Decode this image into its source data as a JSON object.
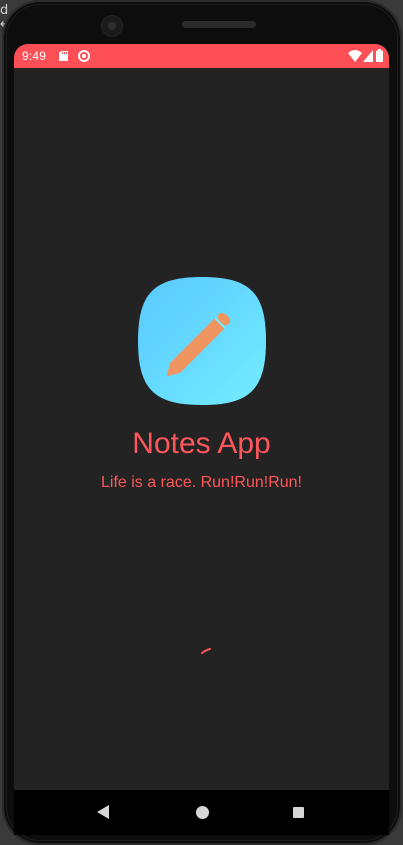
{
  "status_bar": {
    "time": "9:49",
    "icons": [
      "sd-card-icon",
      "data-saver-icon",
      "wifi-icon",
      "signal-icon",
      "battery-icon"
    ],
    "background_color": "#ff4f56"
  },
  "app": {
    "title": "Notes App",
    "tagline": "Life is a race. Run!Run!Run!",
    "icon": "pencil-icon",
    "accent_color": "#ff565c",
    "icon_gradient": [
      "#59c8ff",
      "#74ecff"
    ],
    "pencil_color": "#f0955f",
    "background_color": "#232323"
  },
  "navigation": {
    "buttons": [
      "back-icon",
      "home-icon",
      "recents-icon"
    ]
  }
}
